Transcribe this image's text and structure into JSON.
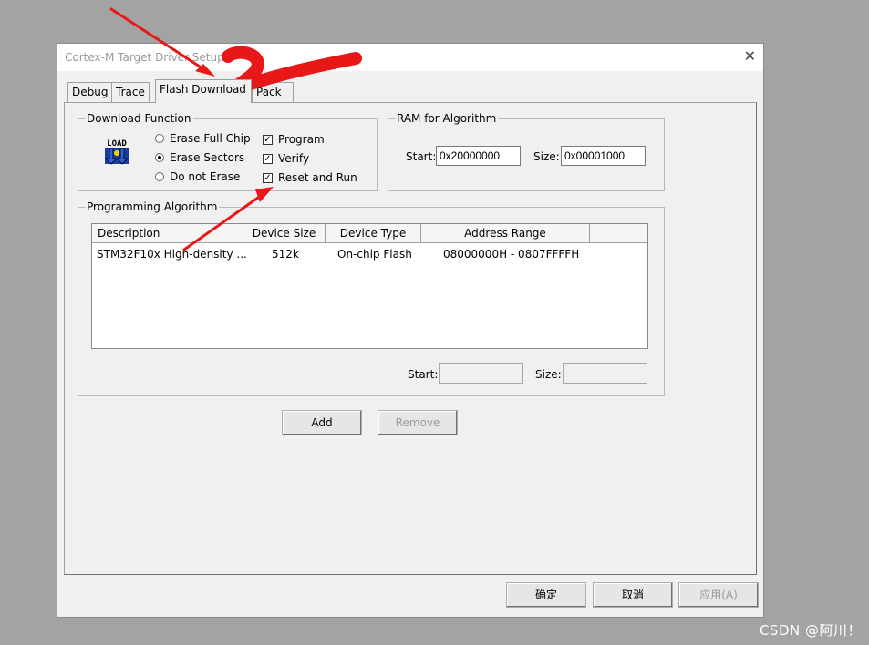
{
  "window": {
    "title": "Cortex-M Target Driver Setup",
    "close_glyph": "✕"
  },
  "tabs": [
    {
      "label": "Debug"
    },
    {
      "label": "Trace"
    },
    {
      "label": "Flash Download",
      "active": true
    },
    {
      "label": "Pack"
    }
  ],
  "download_function": {
    "title": "Download Function",
    "icon_text": "LOAD",
    "erase_options": [
      {
        "label": "Erase Full Chip",
        "selected": false
      },
      {
        "label": "Erase Sectors",
        "selected": true
      },
      {
        "label": "Do not Erase",
        "selected": false
      }
    ],
    "checks": [
      {
        "label": "Program",
        "checked": true
      },
      {
        "label": "Verify",
        "checked": true
      },
      {
        "label": "Reset and Run",
        "checked": true
      }
    ]
  },
  "ram": {
    "title": "RAM for Algorithm",
    "start_label": "Start:",
    "start_value": "0x20000000",
    "size_label": "Size:",
    "size_value": "0x00001000"
  },
  "programming_algorithm": {
    "title": "Programming Algorithm",
    "columns": [
      "Description",
      "Device Size",
      "Device Type",
      "Address Range"
    ],
    "rows": [
      {
        "description": "STM32F10x High-density ...",
        "device_size": "512k",
        "device_type": "On-chip Flash",
        "address_range": "08000000H - 0807FFFFH"
      }
    ],
    "start_label": "Start:",
    "start_value": "",
    "size_label": "Size:",
    "size_value": ""
  },
  "buttons": {
    "add": "Add",
    "remove": "Remove"
  },
  "footer": {
    "ok": "确定",
    "cancel": "取消",
    "apply": "应用(A)"
  },
  "watermark": "CSDN @阿川！",
  "colors": {
    "annotation_red": "#e81818",
    "desktop": "#a3a3a3",
    "dialog": "#f0f0f0"
  }
}
